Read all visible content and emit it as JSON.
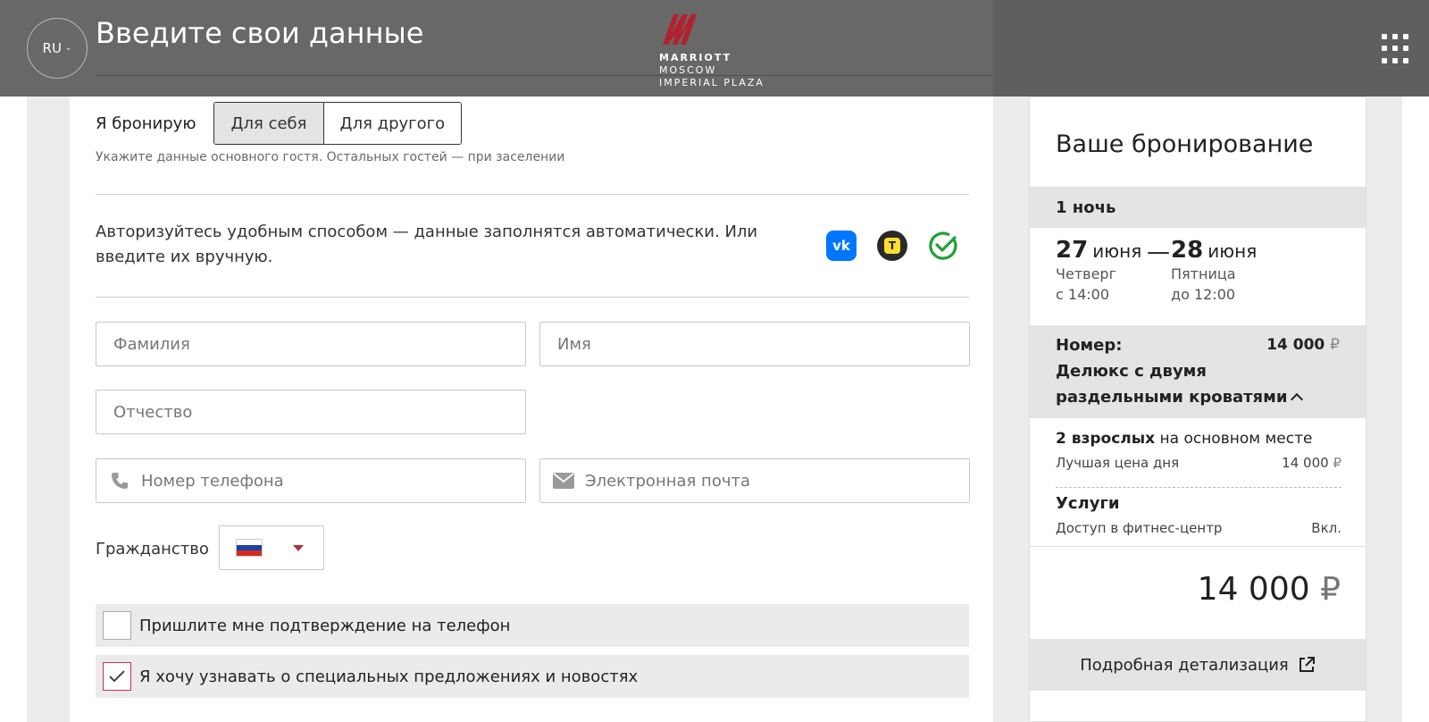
{
  "header": {
    "lang": "RU",
    "title": "Введите свои данные",
    "logo": {
      "line1": "MARRIOTT",
      "line2": "MOSCOW",
      "line3": "IMPERIAL PLAZA"
    },
    "menu_icon": "grid-icon",
    "accent": "#b4212e"
  },
  "booking_for": {
    "label": "Я бронирую",
    "options": [
      "Для себя",
      "Для другого"
    ],
    "selected": "Для себя",
    "hint": "Укажите данные основного гостя. Остальных гостей — при заселении"
  },
  "auth": {
    "text": "Авторизуйтесь удобным способом — данные заполнятся автоматически. Или введите их вручную.",
    "providers": [
      "vk-icon",
      "tinkoff-id-icon",
      "sber-id-icon"
    ]
  },
  "fields": {
    "last_name_placeholder": "Фамилия",
    "first_name_placeholder": "Имя",
    "middle_name_placeholder": "Отчество",
    "phone_placeholder": "Номер телефона",
    "email_placeholder": "Электронная почта",
    "citizenship_label": "Гражданство",
    "citizenship_value": "RU"
  },
  "checkboxes": [
    {
      "label": "Пришлите мне подтверждение на телефон",
      "checked": false
    },
    {
      "label": "Я хочу узнавать о специальных предложениях и новостях",
      "checked": true
    }
  ],
  "summary": {
    "title": "Ваше бронирование",
    "nights": "1 ночь",
    "checkin": {
      "day": "27",
      "month": "июня",
      "weekday": "Четверг",
      "time": "с 14:00"
    },
    "checkout": {
      "day": "28",
      "month": "июня",
      "weekday": "Пятница",
      "time": "до 12:00"
    },
    "dash": "—",
    "room_label": "Номер:",
    "room_price": "14 000",
    "room_name": "Делюкс с двумя раздельными кроватями",
    "guests_bold": "2 взрослых",
    "guests_rest": " на основном месте",
    "rate_name": "Лучшая цена дня",
    "rate_price": "14 000",
    "services_title": "Услуги",
    "service_name": "Доступ в фитнес-центр",
    "service_value": "Вкл.",
    "total": "14 000",
    "currency": "₽",
    "details_link": "Подробная детализация"
  }
}
